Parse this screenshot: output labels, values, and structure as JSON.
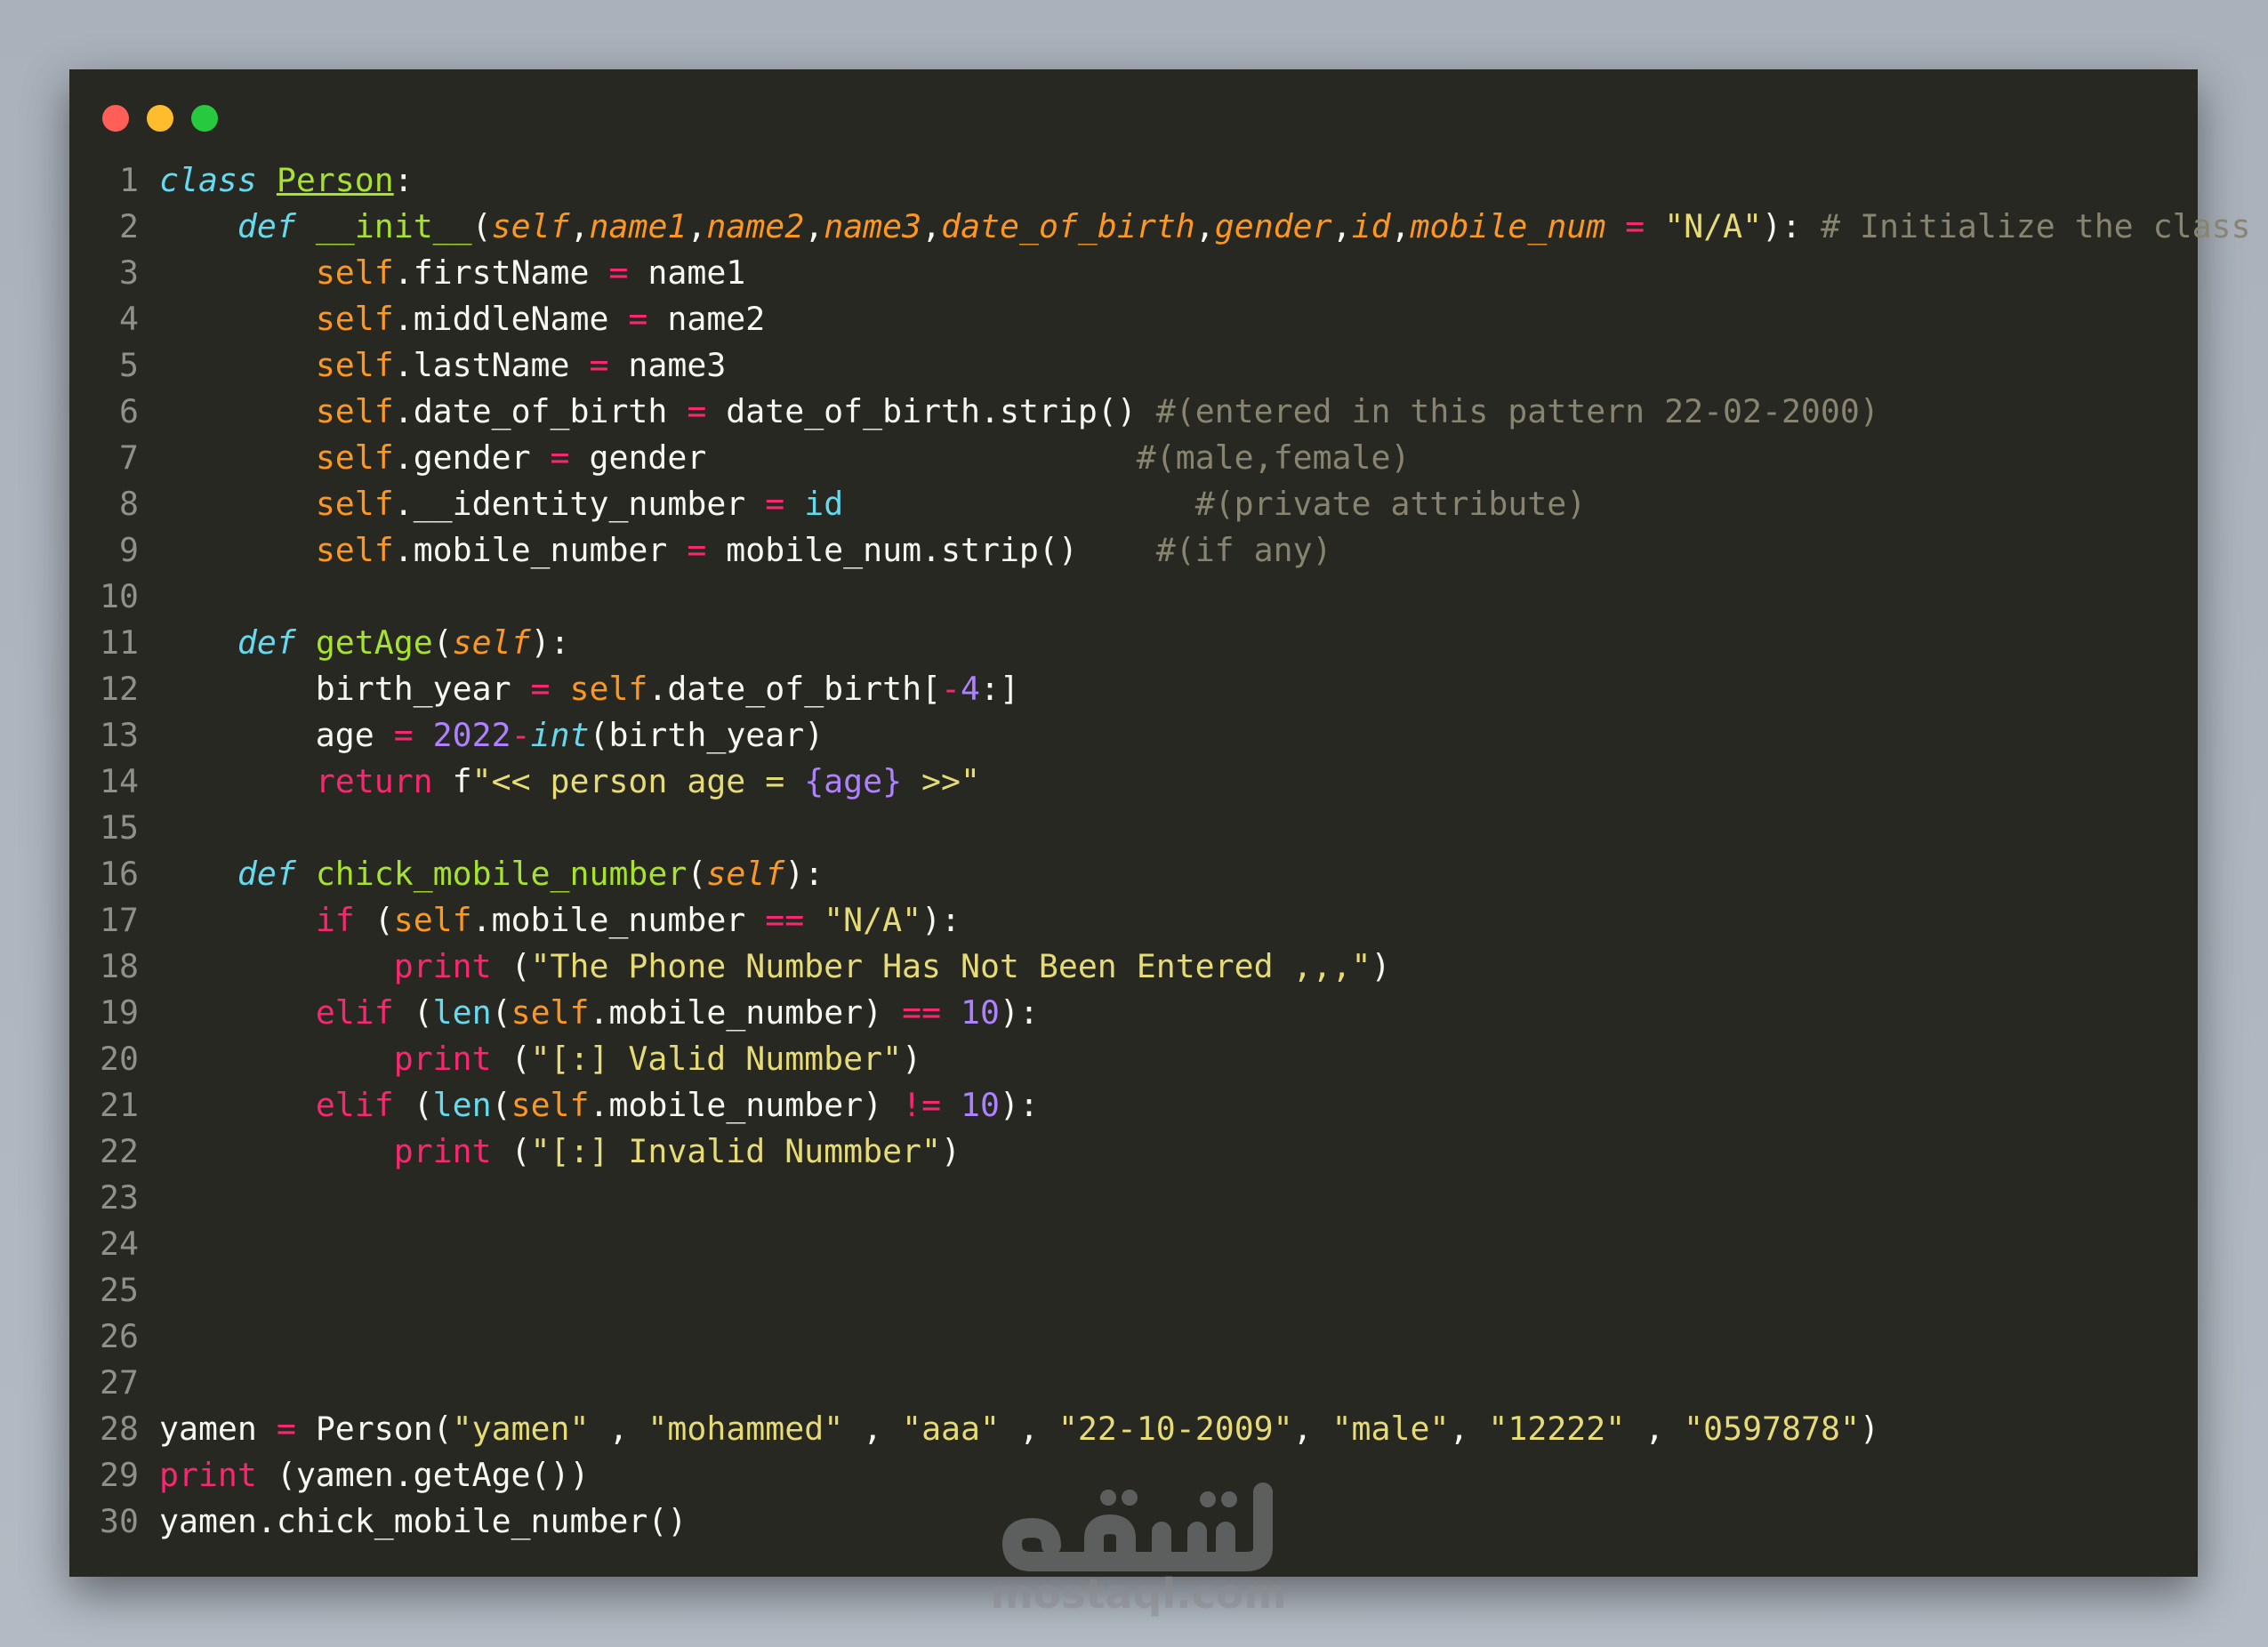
{
  "window": {
    "traffic_lights": [
      {
        "name": "close",
        "color": "#ff5f56"
      },
      {
        "name": "minimize",
        "color": "#ffbd2e"
      },
      {
        "name": "maximize",
        "color": "#27c93f"
      }
    ]
  },
  "code_lines": [
    {
      "n": "1",
      "tokens": [
        [
          "class",
          "kwi"
        ],
        [
          " ",
          "plain"
        ],
        [
          "Person",
          "cls"
        ],
        [
          ":",
          "plain"
        ]
      ]
    },
    {
      "n": "2",
      "tokens": [
        [
          "    ",
          "plain"
        ],
        [
          "def",
          "kwi"
        ],
        [
          " ",
          "plain"
        ],
        [
          "__init__",
          "fn"
        ],
        [
          "(",
          "plain"
        ],
        [
          "self",
          "param"
        ],
        [
          ",",
          "plain"
        ],
        [
          "name1",
          "param"
        ],
        [
          ",",
          "plain"
        ],
        [
          "name2",
          "param"
        ],
        [
          ",",
          "plain"
        ],
        [
          "name3",
          "param"
        ],
        [
          ",",
          "plain"
        ],
        [
          "date_of_birth",
          "param"
        ],
        [
          ",",
          "plain"
        ],
        [
          "gender",
          "param"
        ],
        [
          ",",
          "plain"
        ],
        [
          "id",
          "param"
        ],
        [
          ",",
          "plain"
        ],
        [
          "mobile_num",
          "param"
        ],
        [
          " ",
          "plain"
        ],
        [
          "=",
          "op"
        ],
        [
          " ",
          "plain"
        ],
        [
          "\"N/A\"",
          "str"
        ],
        [
          "): ",
          "plain"
        ],
        [
          "# Initialize the class",
          "cm"
        ]
      ]
    },
    {
      "n": "3",
      "tokens": [
        [
          "        ",
          "plain"
        ],
        [
          "self",
          "self"
        ],
        [
          ".firstName ",
          "plain"
        ],
        [
          "=",
          "op"
        ],
        [
          " name1",
          "plain"
        ]
      ]
    },
    {
      "n": "4",
      "tokens": [
        [
          "        ",
          "plain"
        ],
        [
          "self",
          "self"
        ],
        [
          ".middleName ",
          "plain"
        ],
        [
          "=",
          "op"
        ],
        [
          " name2",
          "plain"
        ]
      ]
    },
    {
      "n": "5",
      "tokens": [
        [
          "        ",
          "plain"
        ],
        [
          "self",
          "self"
        ],
        [
          ".lastName ",
          "plain"
        ],
        [
          "=",
          "op"
        ],
        [
          " name3",
          "plain"
        ]
      ]
    },
    {
      "n": "6",
      "tokens": [
        [
          "        ",
          "plain"
        ],
        [
          "self",
          "self"
        ],
        [
          ".date_of_birth ",
          "plain"
        ],
        [
          "=",
          "op"
        ],
        [
          " date_of_birth.strip() ",
          "plain"
        ],
        [
          "#(entered in this pattern 22-02-2000)",
          "cm"
        ]
      ]
    },
    {
      "n": "7",
      "tokens": [
        [
          "        ",
          "plain"
        ],
        [
          "self",
          "self"
        ],
        [
          ".gender ",
          "plain"
        ],
        [
          "=",
          "op"
        ],
        [
          " gender                      ",
          "plain"
        ],
        [
          "#(male,female)",
          "cm"
        ]
      ]
    },
    {
      "n": "8",
      "tokens": [
        [
          "        ",
          "plain"
        ],
        [
          "self",
          "self"
        ],
        [
          ".__identity_number ",
          "plain"
        ],
        [
          "=",
          "op"
        ],
        [
          " ",
          "plain"
        ],
        [
          "id",
          "bi"
        ],
        [
          "                  ",
          "plain"
        ],
        [
          "#(private attribute)",
          "cm"
        ]
      ]
    },
    {
      "n": "9",
      "tokens": [
        [
          "        ",
          "plain"
        ],
        [
          "self",
          "self"
        ],
        [
          ".mobile_number ",
          "plain"
        ],
        [
          "=",
          "op"
        ],
        [
          " mobile_num.strip()    ",
          "plain"
        ],
        [
          "#(if any)",
          "cm"
        ]
      ]
    },
    {
      "n": "10",
      "tokens": []
    },
    {
      "n": "11",
      "tokens": [
        [
          "    ",
          "plain"
        ],
        [
          "def",
          "kwi"
        ],
        [
          " ",
          "plain"
        ],
        [
          "getAge",
          "fn"
        ],
        [
          "(",
          "plain"
        ],
        [
          "self",
          "param"
        ],
        [
          "):",
          "plain"
        ]
      ]
    },
    {
      "n": "12",
      "tokens": [
        [
          "        birth_year ",
          "plain"
        ],
        [
          "=",
          "op"
        ],
        [
          " ",
          "plain"
        ],
        [
          "self",
          "self"
        ],
        [
          ".date_of_birth[",
          "plain"
        ],
        [
          "-",
          "op"
        ],
        [
          "4",
          "num"
        ],
        [
          ":]",
          "plain"
        ]
      ]
    },
    {
      "n": "13",
      "tokens": [
        [
          "        age ",
          "plain"
        ],
        [
          "=",
          "op"
        ],
        [
          " ",
          "plain"
        ],
        [
          "2022",
          "num"
        ],
        [
          "-",
          "op"
        ],
        [
          "int",
          "bii"
        ],
        [
          "(birth_year)",
          "plain"
        ]
      ]
    },
    {
      "n": "14",
      "tokens": [
        [
          "        ",
          "plain"
        ],
        [
          "return",
          "kw"
        ],
        [
          " f",
          "plain"
        ],
        [
          "\"<< person age = ",
          "str"
        ],
        [
          "{age}",
          "num"
        ],
        [
          " >>\"",
          "str"
        ]
      ]
    },
    {
      "n": "15",
      "tokens": []
    },
    {
      "n": "16",
      "tokens": [
        [
          "    ",
          "plain"
        ],
        [
          "def",
          "kwi"
        ],
        [
          " ",
          "plain"
        ],
        [
          "chick_mobile_number",
          "fn"
        ],
        [
          "(",
          "plain"
        ],
        [
          "self",
          "param"
        ],
        [
          "):",
          "plain"
        ]
      ]
    },
    {
      "n": "17",
      "tokens": [
        [
          "        ",
          "plain"
        ],
        [
          "if",
          "kw"
        ],
        [
          " (",
          "plain"
        ],
        [
          "self",
          "self"
        ],
        [
          ".mobile_number ",
          "plain"
        ],
        [
          "==",
          "op"
        ],
        [
          " ",
          "plain"
        ],
        [
          "\"N/A\"",
          "str"
        ],
        [
          "):",
          "plain"
        ]
      ]
    },
    {
      "n": "18",
      "tokens": [
        [
          "            ",
          "plain"
        ],
        [
          "print",
          "kw"
        ],
        [
          " (",
          "plain"
        ],
        [
          "\"The Phone Number Has Not Been Entered ,,,\"",
          "str"
        ],
        [
          ")",
          "plain"
        ]
      ]
    },
    {
      "n": "19",
      "tokens": [
        [
          "        ",
          "plain"
        ],
        [
          "elif",
          "kw"
        ],
        [
          " (",
          "plain"
        ],
        [
          "len",
          "bi"
        ],
        [
          "(",
          "plain"
        ],
        [
          "self",
          "self"
        ],
        [
          ".mobile_number) ",
          "plain"
        ],
        [
          "==",
          "op"
        ],
        [
          " ",
          "plain"
        ],
        [
          "10",
          "num"
        ],
        [
          "):",
          "plain"
        ]
      ]
    },
    {
      "n": "20",
      "tokens": [
        [
          "            ",
          "plain"
        ],
        [
          "print",
          "kw"
        ],
        [
          " (",
          "plain"
        ],
        [
          "\"[:] Valid Nummber\"",
          "str"
        ],
        [
          ")",
          "plain"
        ]
      ]
    },
    {
      "n": "21",
      "tokens": [
        [
          "        ",
          "plain"
        ],
        [
          "elif",
          "kw"
        ],
        [
          " (",
          "plain"
        ],
        [
          "len",
          "bi"
        ],
        [
          "(",
          "plain"
        ],
        [
          "self",
          "self"
        ],
        [
          ".mobile_number) ",
          "plain"
        ],
        [
          "!=",
          "op"
        ],
        [
          " ",
          "plain"
        ],
        [
          "10",
          "num"
        ],
        [
          "):",
          "plain"
        ]
      ]
    },
    {
      "n": "22",
      "tokens": [
        [
          "            ",
          "plain"
        ],
        [
          "print",
          "kw"
        ],
        [
          " (",
          "plain"
        ],
        [
          "\"[:] Invalid Nummber\"",
          "str"
        ],
        [
          ")",
          "plain"
        ]
      ]
    },
    {
      "n": "23",
      "tokens": []
    },
    {
      "n": "24",
      "tokens": []
    },
    {
      "n": "25",
      "tokens": []
    },
    {
      "n": "26",
      "tokens": []
    },
    {
      "n": "27",
      "tokens": []
    },
    {
      "n": "28",
      "tokens": [
        [
          "yamen ",
          "plain"
        ],
        [
          "=",
          "op"
        ],
        [
          " Person(",
          "plain"
        ],
        [
          "\"yamen\"",
          "str"
        ],
        [
          " , ",
          "plain"
        ],
        [
          "\"mohammed\"",
          "str"
        ],
        [
          " , ",
          "plain"
        ],
        [
          "\"aaa\"",
          "str"
        ],
        [
          " , ",
          "plain"
        ],
        [
          "\"22-10-2009\"",
          "str"
        ],
        [
          ", ",
          "plain"
        ],
        [
          "\"male\"",
          "str"
        ],
        [
          ", ",
          "plain"
        ],
        [
          "\"12222\"",
          "str"
        ],
        [
          " , ",
          "plain"
        ],
        [
          "\"0597878\"",
          "str"
        ],
        [
          ")",
          "plain"
        ]
      ]
    },
    {
      "n": "29",
      "tokens": [
        [
          "print",
          "kw"
        ],
        [
          " (yamen.getAge())",
          "plain"
        ]
      ]
    },
    {
      "n": "30",
      "tokens": [
        [
          "yamen.chick_mobile_number()",
          "plain"
        ]
      ]
    }
  ],
  "watermark": {
    "text": "mostaql.com",
    "logo_text": "مستقل"
  }
}
